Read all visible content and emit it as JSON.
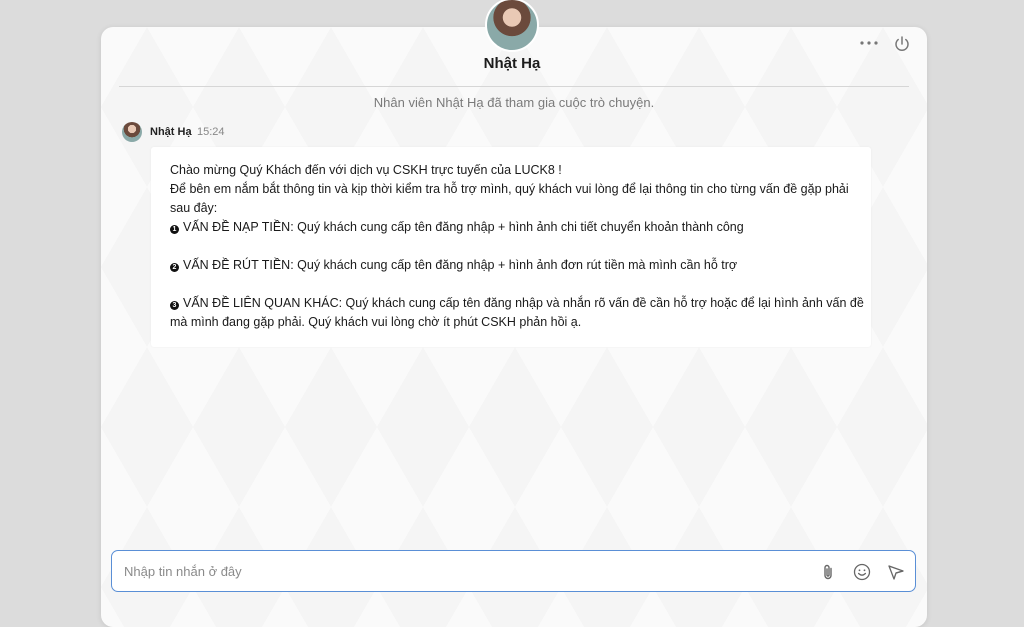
{
  "header": {
    "agent_name": "Nhật Hạ"
  },
  "chat": {
    "system_message": "Nhân viên Nhật Hạ đã tham gia cuộc trò chuyện.",
    "message": {
      "sender": "Nhật Hạ",
      "time": "15:24",
      "lines": [
        "Chào mừng Quý Khách đến với dịch vụ CSKH trực tuyến của LUCK8 !",
        "Để bên em nắm bắt thông tin và kịp thời kiểm tra hỗ trợ mình, quý khách vui lòng để lại thông tin cho từng vấn đề gặp phải",
        "sau đây:"
      ],
      "items": [
        {
          "number": "1",
          "text": "VẤN ĐỀ NẠP TIỀN: Quý khách cung cấp tên đăng nhập + hình ảnh chi tiết chuyển khoản thành công"
        },
        {
          "number": "2",
          "text": "VẤN ĐỀ RÚT TIỀN: Quý khách cung cấp tên đăng nhập + hình ảnh đơn rút tiền mà mình cần hỗ trợ"
        },
        {
          "number": "3",
          "text": "VẤN ĐỀ LIÊN QUAN KHÁC: Quý khách cung cấp tên đăng nhập và nhắn rõ vấn đề cần hỗ trợ hoặc để lại hình ảnh vấn đề",
          "continuation": "mà mình đang gặp phải. Quý khách vui lòng chờ ít phút CSKH phản hồi ạ."
        }
      ]
    }
  },
  "composer": {
    "placeholder": "Nhập tin nhắn ở đây",
    "value": ""
  },
  "icons": {
    "menu": "more-horizontal-icon",
    "power": "power-icon",
    "attach": "paperclip-icon",
    "emoji": "smiley-icon",
    "send": "send-icon"
  },
  "colors": {
    "input_border": "#5a8fd6",
    "background": "#f5f5f5"
  }
}
